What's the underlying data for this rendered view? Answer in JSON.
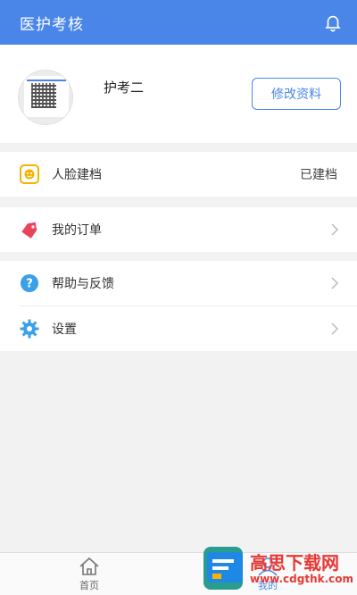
{
  "header": {
    "title": "医护考核",
    "bell_icon": "bell-icon"
  },
  "profile": {
    "name": "护考二",
    "edit_label": "修改资料"
  },
  "face": {
    "label": "人脸建档",
    "status": "已建档",
    "icon": "face-scan-icon",
    "icon_color": "#f5b400"
  },
  "orders": {
    "label": "我的订单",
    "icon": "tag-icon",
    "icon_color": "#e8455a"
  },
  "help": {
    "label": "帮助与反馈",
    "icon": "question-icon",
    "icon_color": "#3aa0e8"
  },
  "settings": {
    "label": "设置",
    "icon": "gear-icon",
    "icon_color": "#3aa0e8"
  },
  "tabs": [
    {
      "label": "首页",
      "icon": "home-icon"
    },
    {
      "label": "我的",
      "icon": "user-icon"
    }
  ],
  "watermark": {
    "line1": "高思下载网",
    "line2": "www.cdgthk.com"
  },
  "colors": {
    "primary": "#4a86e8",
    "background": "#f2f2f2"
  }
}
